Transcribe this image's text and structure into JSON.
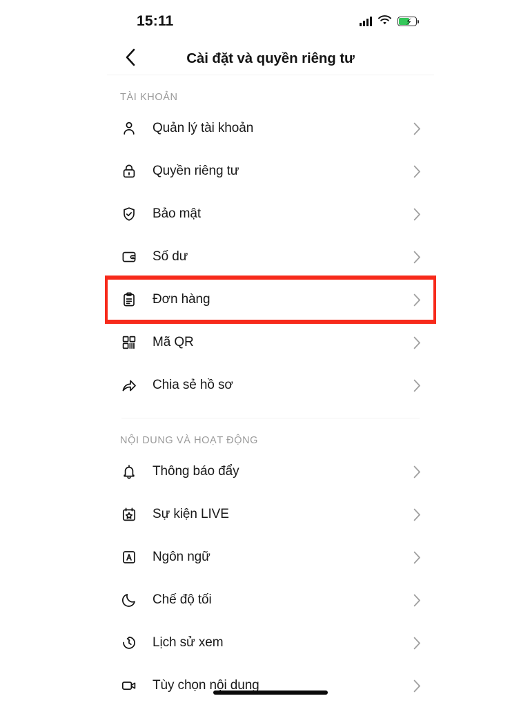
{
  "status_bar": {
    "time": "15:11",
    "signal_icon": "cellular-signal-icon",
    "wifi_icon": "wifi-icon",
    "battery_icon": "battery-charging-icon",
    "battery_color": "#34c759",
    "battery_charging": true
  },
  "header": {
    "back_icon": "chevron-left-icon",
    "title": "Cài đặt và quyền riêng tư"
  },
  "highlight": {
    "color": "#f72a1b",
    "target_row": "Đơn hàng"
  },
  "sections": [
    {
      "label": "TÀI KHOẢN",
      "items": [
        {
          "label": "Quản lý tài khoản",
          "icon": "person-icon",
          "chevron": "chevron-right-icon",
          "highlighted": false
        },
        {
          "label": "Quyền riêng tư",
          "icon": "lock-icon",
          "chevron": "chevron-right-icon",
          "highlighted": false
        },
        {
          "label": "Bảo mật",
          "icon": "shield-check-icon",
          "chevron": "chevron-right-icon",
          "highlighted": false
        },
        {
          "label": "Số dư",
          "icon": "wallet-icon",
          "chevron": "chevron-right-icon",
          "highlighted": false
        },
        {
          "label": "Đơn hàng",
          "icon": "clipboard-list-icon",
          "chevron": "chevron-right-icon",
          "highlighted": true
        },
        {
          "label": "Mã QR",
          "icon": "qr-code-icon",
          "chevron": "chevron-right-icon",
          "highlighted": false
        },
        {
          "label": "Chia sẻ hồ sơ",
          "icon": "share-arrow-icon",
          "chevron": "chevron-right-icon",
          "highlighted": false
        }
      ]
    },
    {
      "label": "NỘI DUNG VÀ HOẠT ĐỘNG",
      "items": [
        {
          "label": "Thông báo đẩy",
          "icon": "bell-icon",
          "chevron": "chevron-right-icon",
          "highlighted": false
        },
        {
          "label": "Sự kiện LIVE",
          "icon": "calendar-star-icon",
          "chevron": "chevron-right-icon",
          "highlighted": false
        },
        {
          "label": "Ngôn ngữ",
          "icon": "language-a-box-icon",
          "chevron": "chevron-right-icon",
          "highlighted": false
        },
        {
          "label": "Chế độ tối",
          "icon": "moon-icon",
          "chevron": "chevron-right-icon",
          "highlighted": false
        },
        {
          "label": "Lịch sử xem",
          "icon": "clock-history-icon",
          "chevron": "chevron-right-icon",
          "highlighted": false
        },
        {
          "label": "Tùy chọn nội dung",
          "icon": "video-camera-icon",
          "chevron": "chevron-right-icon",
          "highlighted": false
        }
      ]
    }
  ],
  "home_indicator": "home-indicator-bar"
}
